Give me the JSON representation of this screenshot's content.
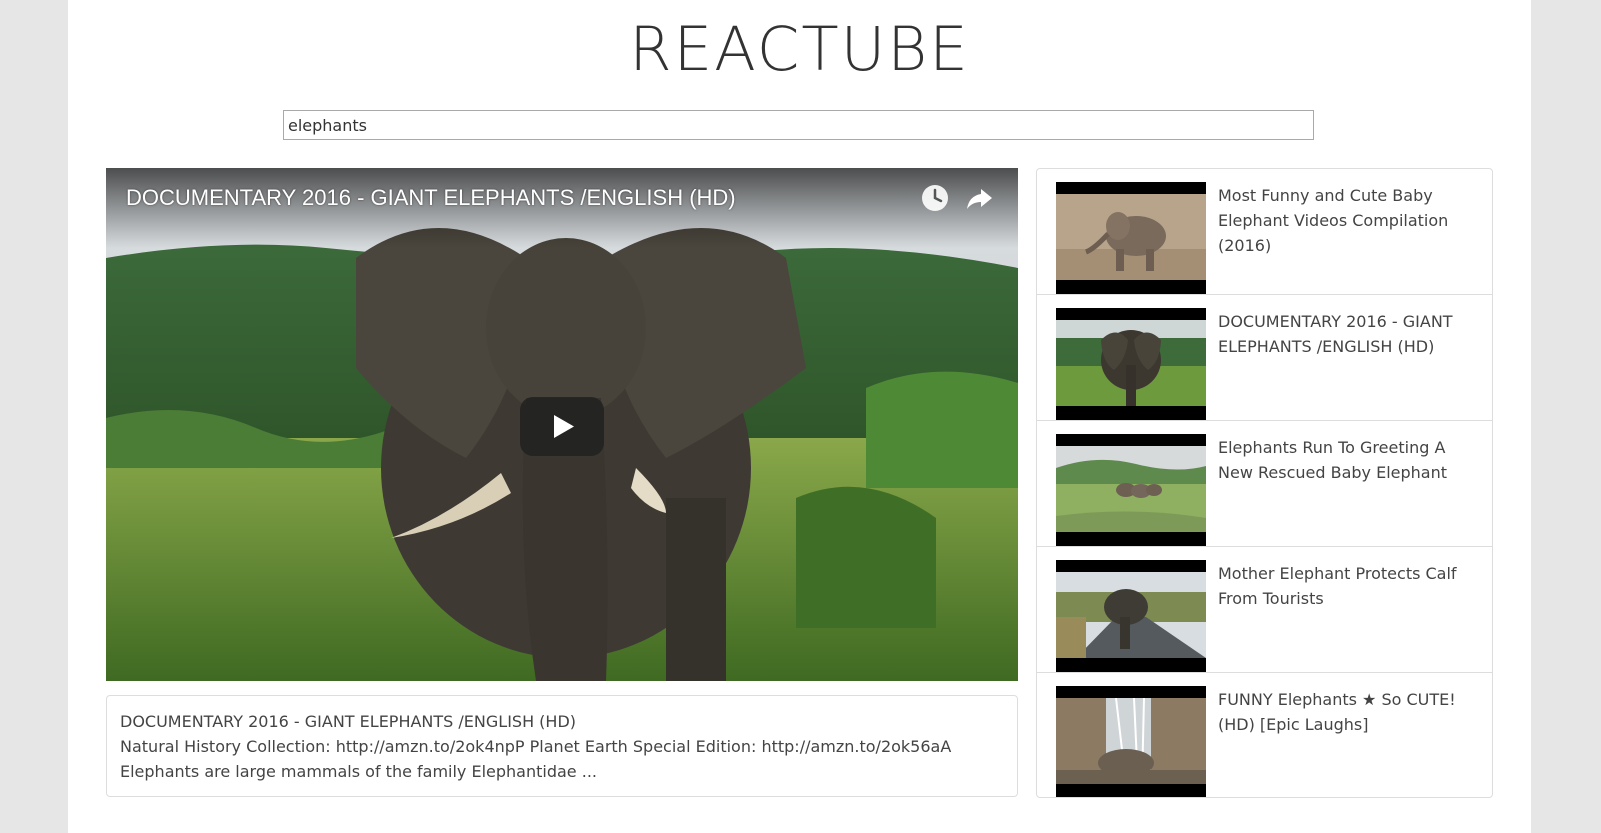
{
  "app": {
    "title": "REACTUBE"
  },
  "search": {
    "value": "elephants"
  },
  "player": {
    "title": "DOCUMENTARY 2016 - GIANT ELEPHANTS /ENGLISH (HD)",
    "icons": [
      "watch-later-icon",
      "share-icon",
      "play-icon"
    ]
  },
  "details": {
    "title": "DOCUMENTARY 2016 - GIANT ELEPHANTS /ENGLISH (HD)",
    "description_line1": "Natural History Collection: http://amzn.to/2ok4npP Planet Earth Special Edition: http://amzn.to/2ok56aA",
    "description_line2": "Elephants are large mammals of the family Elephantidae ..."
  },
  "videos": [
    {
      "title": "Most Funny and Cute Baby Elephant Videos Compilation (2016)"
    },
    {
      "title": "DOCUMENTARY 2016 - GIANT ELEPHANTS /ENGLISH (HD)"
    },
    {
      "title": "Elephants Run To Greeting A New Rescued Baby Elephant"
    },
    {
      "title": "Mother Elephant Protects Calf From Tourists"
    },
    {
      "title": "FUNNY Elephants ★ So CUTE! (HD) [Epic Laughs]"
    }
  ],
  "colors": {
    "background": "#e6e6e6",
    "page": "#ffffff",
    "text": "#444444",
    "border": "#dddddd"
  }
}
